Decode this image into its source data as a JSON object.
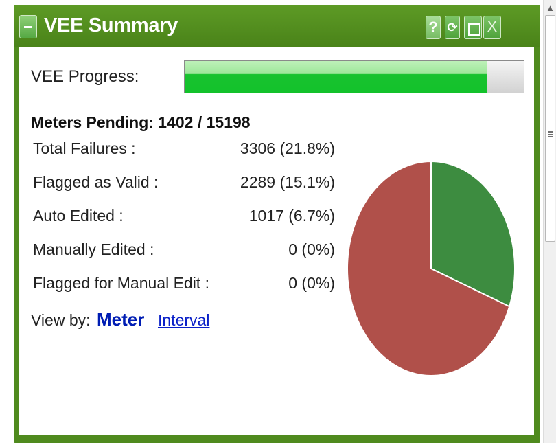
{
  "widget": {
    "title": "VEE Summary",
    "icons": {
      "collapse": "minus-icon",
      "help": "question-mark-icon",
      "refresh": "refresh-icon",
      "maximize": "maximize-icon",
      "close": "close-icon"
    },
    "help_glyph": "?",
    "refresh_glyph": "⟳",
    "close_glyph": "X"
  },
  "progress": {
    "label": "VEE Progress:",
    "fraction": 0.893,
    "fill_color": "#18c22f"
  },
  "pending": {
    "text": "Meters Pending: 1402 / 15198"
  },
  "stats": [
    {
      "label": "Total Failures :",
      "value": "3306 (21.8%)"
    },
    {
      "label": "Flagged as Valid :",
      "value": "2289 (15.1%)"
    },
    {
      "label": "Auto Edited :",
      "value": "1017 (6.7%)"
    },
    {
      "label": "Manually Edited :",
      "value": "0 (0%)"
    },
    {
      "label": "Flagged for Manual Edit :",
      "value": "0 (0%)"
    }
  ],
  "view_by": {
    "label": "View by:",
    "meter": "Meter",
    "interval": "Interval"
  },
  "chart_data": {
    "type": "pie",
    "slices": [
      {
        "value": 1017,
        "color": "#3d8c40"
      },
      {
        "value": 2289,
        "color": "#b0504a"
      }
    ]
  }
}
